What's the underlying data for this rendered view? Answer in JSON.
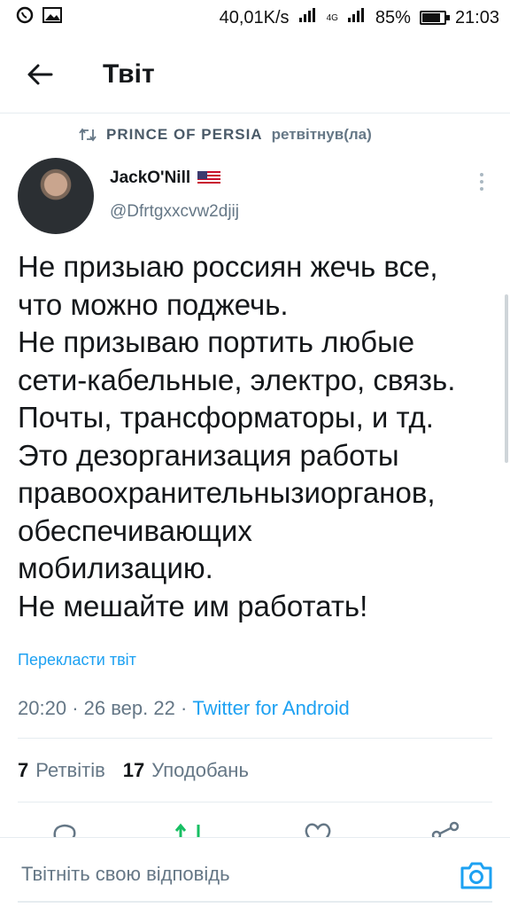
{
  "status_bar": {
    "network_speed": "40,01K/s",
    "network_type": "4G",
    "battery": "85%",
    "battery_level": 0.85,
    "time": "21:03"
  },
  "header": {
    "title": "Твіт"
  },
  "retweet": {
    "retweeter": "PRINCE OF PERSIA",
    "label": "ретвітнув(ла)"
  },
  "author": {
    "name": "JackO'Nill",
    "handle": "@Dfrtgxxcvw2djij"
  },
  "tweet": {
    "lines": [
      "Не призыаю россиян жечь все,",
      "что можно поджечь.",
      "Не призываю портить любые",
      "сети-кабельные, электро, связь.",
      "Почты, трансформаторы, и тд.",
      "Это дезорганизация работы",
      "правоохранительнызиорганов,",
      "обеспечивающих",
      "мобилизацию.",
      "Не мешайте им работать!"
    ],
    "translate_label": "Перекласти твіт",
    "time": "20:20",
    "date": "26 вер. 22",
    "separator": "·",
    "source": "Twitter for Android"
  },
  "stats": {
    "retweets_count": "7",
    "retweets_label": "Ретвітів",
    "likes_count": "17",
    "likes_label": "Уподобань"
  },
  "reply": {
    "placeholder": "Твітніть свою відповідь"
  },
  "colors": {
    "accent": "#1da1f2",
    "retweet_green": "#17bf63",
    "muted": "#657786"
  }
}
